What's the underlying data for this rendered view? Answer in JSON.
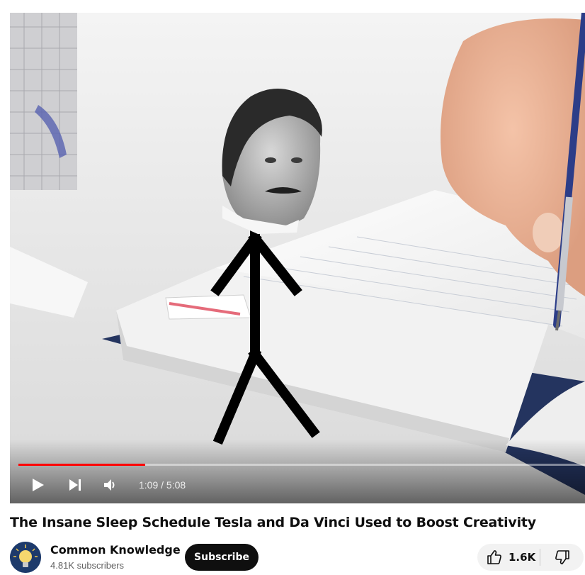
{
  "player": {
    "current_time": "1:09",
    "separator": " / ",
    "duration": "5:08",
    "progress_fraction": 0.2239,
    "icons": {
      "play": "play-icon",
      "next": "next-icon",
      "volume": "volume-icon"
    },
    "accent_color": "#ff0000"
  },
  "video": {
    "title": "The Insane Sleep Schedule Tesla and Da Vinci Used to Boost Creativity"
  },
  "channel": {
    "name": "Common Knowledge",
    "subscribers": "4.81K subscribers"
  },
  "actions": {
    "subscribe_label": "Subscribe",
    "like_count": "1.6K",
    "like_icon": "thumbs-up-icon",
    "dislike_icon": "thumbs-down-icon"
  }
}
